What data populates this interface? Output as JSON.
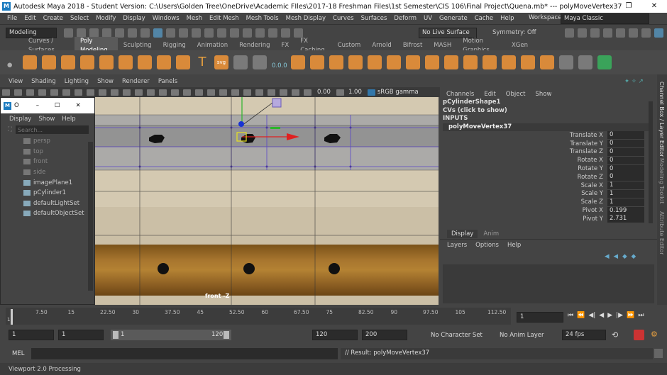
{
  "title_bar": {
    "app_icon": "maya-logo",
    "title": "Autodesk Maya 2018 - Student Version: C:\\Users\\Golden Tree\\OneDrive\\Academic FIles\\2017-18 Freshman Files\\1st Semester\\CIS 106\\Final Project\\Quena.mb*  ---  polyMoveVertex37",
    "minimize": "–",
    "restore": "❐",
    "close": "✕"
  },
  "menu": [
    "File",
    "Edit",
    "Create",
    "Select",
    "Modify",
    "Display",
    "Windows",
    "Mesh",
    "Edit Mesh",
    "Mesh Tools",
    "Mesh Display",
    "Curves",
    "Surfaces",
    "Deform",
    "UV",
    "Generate",
    "Cache",
    "Help"
  ],
  "workspace": {
    "label": "Workspace :",
    "value": "Maya Classic"
  },
  "mode_menu": "Modeling",
  "live_surface": "No Live Surface",
  "symmetry": "Symmetry: Off",
  "shelf_tabs": [
    "Curves / Surfaces",
    "Poly Modeling",
    "Sculpting",
    "Rigging",
    "Animation",
    "Rendering",
    "FX",
    "FX Caching",
    "Custom",
    "Arnold",
    "Bifrost",
    "MASH",
    "Motion Graphics",
    "XGen"
  ],
  "active_shelf_tab": "Poly Modeling",
  "shelf_value": "0.0.0",
  "viewport": {
    "menu": [
      "View",
      "Shading",
      "Lighting",
      "Show",
      "Renderer",
      "Panels"
    ],
    "gamma_value": "0.00",
    "exposure_value": "1.00",
    "color_space": "sRGB gamma",
    "camera_label": "front -Z"
  },
  "outliner": {
    "title": "O",
    "menu": [
      "Display",
      "Show",
      "Help"
    ],
    "search_placeholder": "Search...",
    "items": [
      {
        "label": "persp",
        "icon": "camera-icon",
        "dim": true
      },
      {
        "label": "top",
        "icon": "camera-icon",
        "dim": true
      },
      {
        "label": "front",
        "icon": "camera-icon",
        "dim": true
      },
      {
        "label": "side",
        "icon": "camera-icon",
        "dim": true
      },
      {
        "label": "imagePlane1",
        "icon": "image-plane-icon",
        "dim": false
      },
      {
        "label": "pCylinder1",
        "icon": "mesh-icon",
        "dim": false
      },
      {
        "label": "defaultLightSet",
        "icon": "set-icon",
        "dim": false
      },
      {
        "label": "defaultObjectSet",
        "icon": "set-icon",
        "dim": false
      }
    ]
  },
  "channel_box": {
    "menu": [
      "Channels",
      "Edit",
      "Object",
      "Show"
    ],
    "shape": "pCylinderShape1",
    "cvs": "CVs (click to show)",
    "inputs": "INPUTS",
    "node": "polyMoveVertex37",
    "attributes": [
      {
        "name": "Translate X",
        "value": "0"
      },
      {
        "name": "Translate Y",
        "value": "0"
      },
      {
        "name": "Translate Z",
        "value": "0"
      },
      {
        "name": "Rotate X",
        "value": "0"
      },
      {
        "name": "Rotate Y",
        "value": "0"
      },
      {
        "name": "Rotate Z",
        "value": "0"
      },
      {
        "name": "Scale X",
        "value": "1"
      },
      {
        "name": "Scale Y",
        "value": "1"
      },
      {
        "name": "Scale Z",
        "value": "1"
      },
      {
        "name": "Pivot X",
        "value": "0.199"
      },
      {
        "name": "Pivot Y",
        "value": "2.731"
      }
    ]
  },
  "side_tabs": [
    "Channel Box / Layer Editor",
    "Modeling Toolkit",
    "Attribute Editor"
  ],
  "layer_editor": {
    "tabs": [
      "Display",
      "Anim"
    ],
    "menu": [
      "Layers",
      "Options",
      "Help"
    ]
  },
  "timeline": {
    "ticks": [
      "7.50",
      "15",
      "22.50",
      "30",
      "37.50",
      "45",
      "52.50",
      "60",
      "67.50",
      "75",
      "82.50",
      "90",
      "97.50",
      "105",
      "112.50"
    ],
    "start_tick": "1",
    "current_frame": "1"
  },
  "range": {
    "start": "1",
    "playback_start": "1",
    "slider_start": "1",
    "slider_end": "120",
    "playback_end": "120",
    "end": "200",
    "character_set": "No Character Set",
    "anim_layer": "No Anim Layer",
    "fps": "24 fps"
  },
  "command": {
    "label": "MEL",
    "result": "// Result: polyMoveVertex37"
  },
  "help_line": "Viewport 2.0 Processing"
}
